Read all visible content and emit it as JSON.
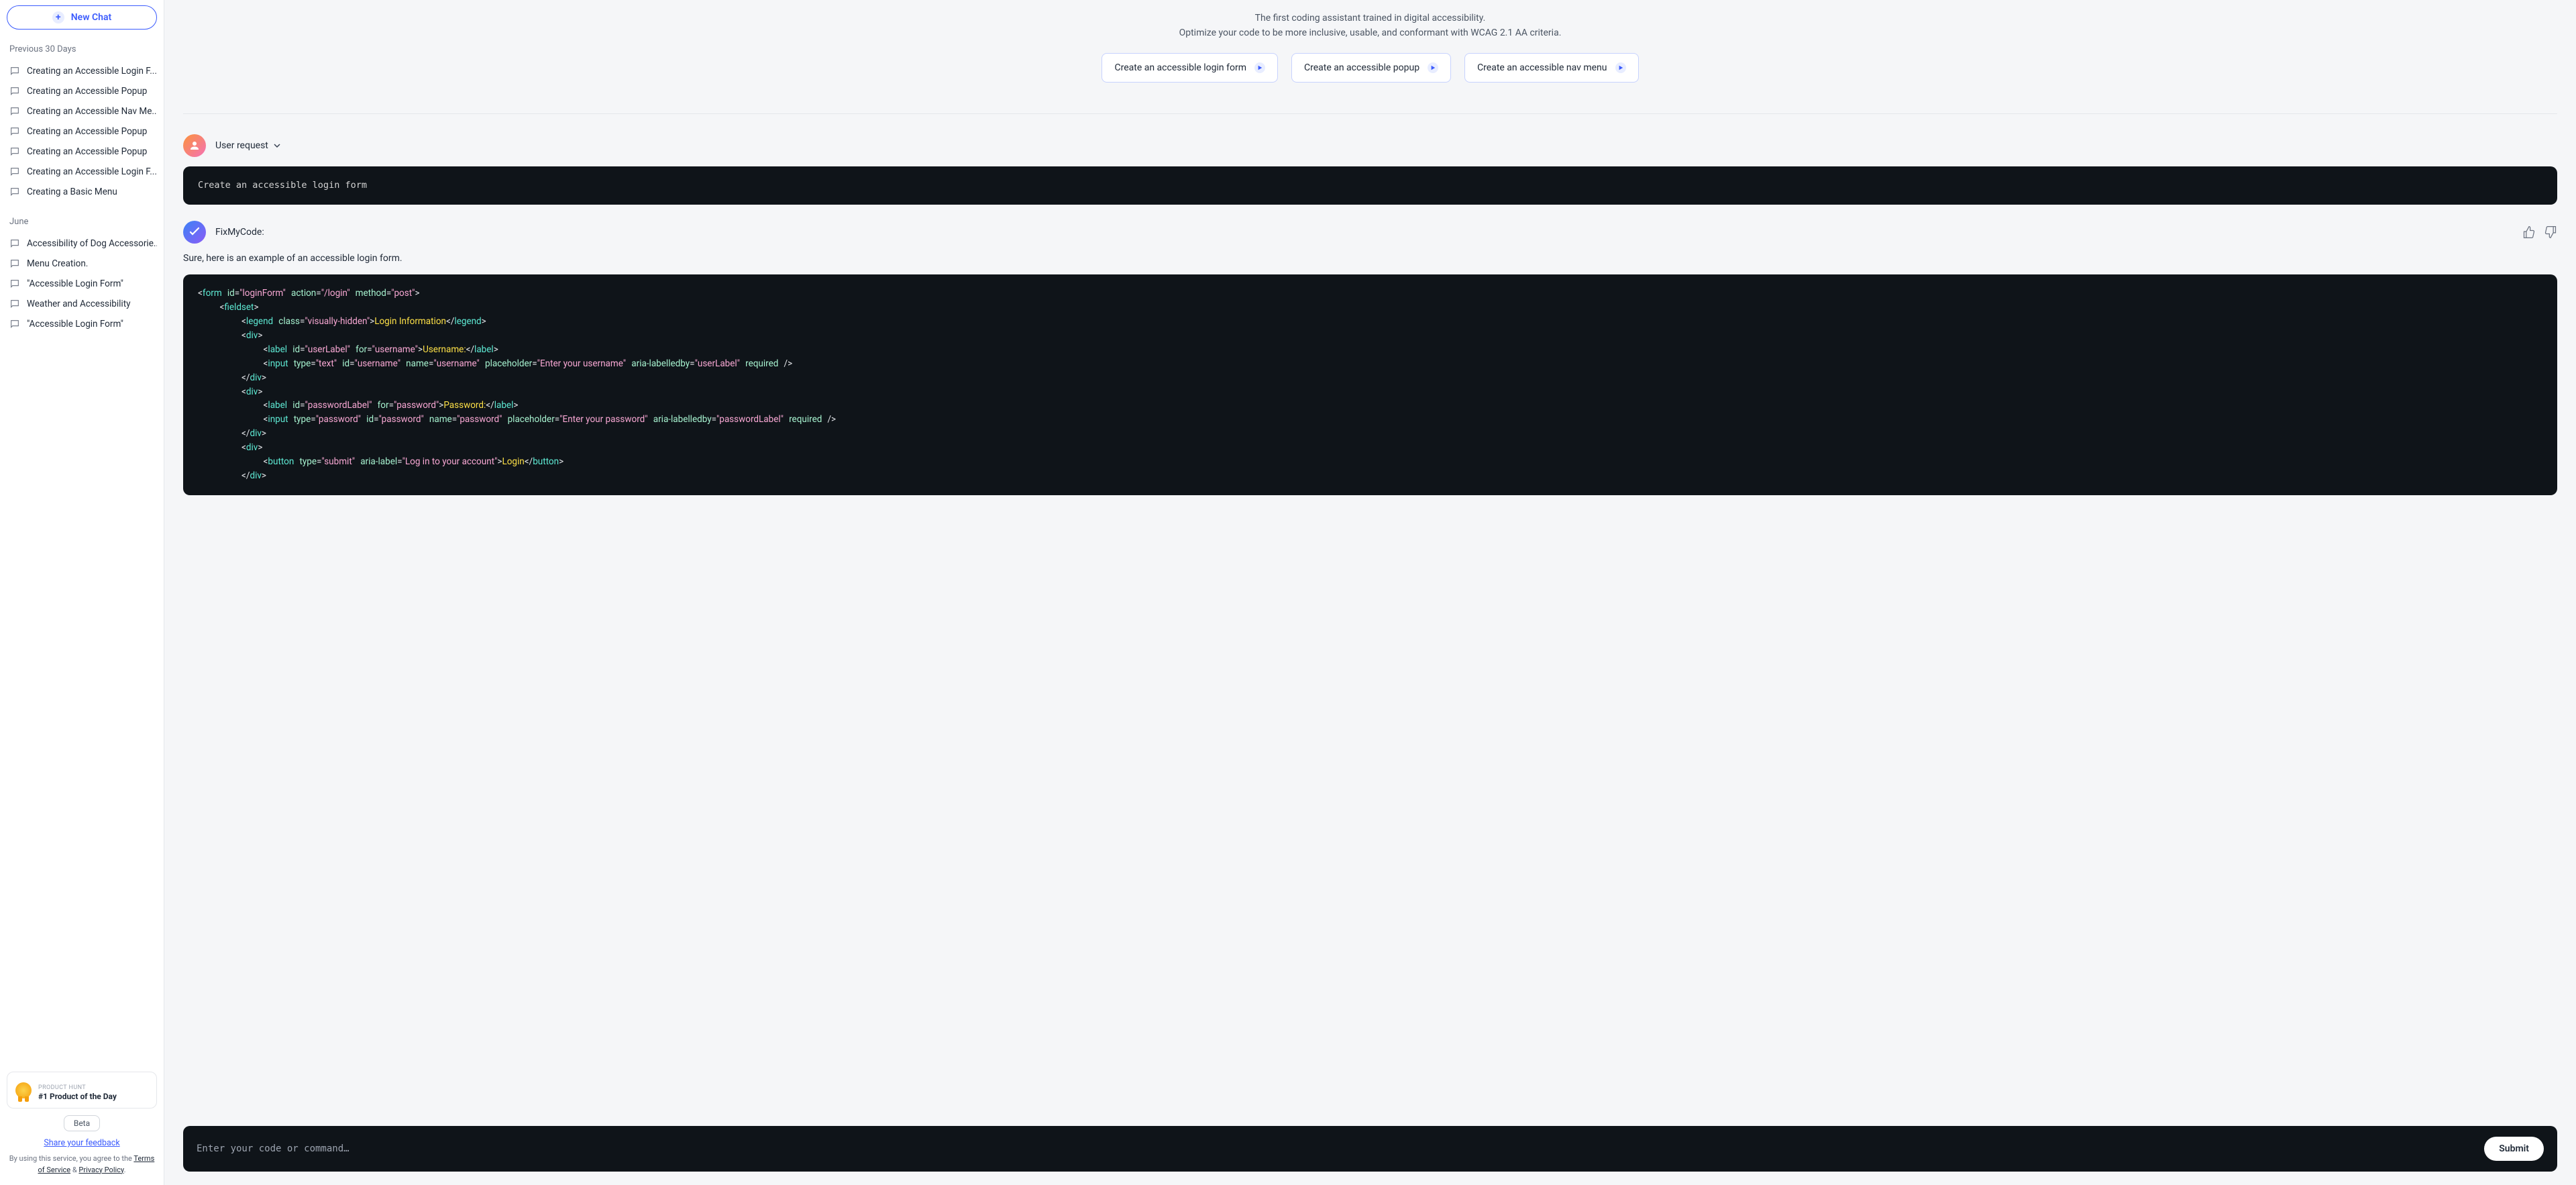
{
  "sidebar": {
    "newChat": "New Chat",
    "sections": {
      "recent": "Previous 30 Days",
      "june": "June"
    },
    "recent": [
      "Creating an Accessible Login F...",
      "Creating an Accessible Popup",
      "Creating an Accessible Nav Me...",
      "Creating an Accessible Popup",
      "Creating an Accessible Popup",
      "Creating an Accessible Login F...",
      "Creating a Basic Menu"
    ],
    "june": [
      "Accessibility of Dog Accessorie...",
      "Menu Creation.",
      "\"Accessible Login Form\"",
      "Weather and Accessibility",
      "\"Accessible Login Form\""
    ],
    "badge": {
      "eyebrow": "PRODUCT HUNT",
      "title": "#1 Product of the Day"
    },
    "beta": "Beta",
    "feedback": "Share your feedback",
    "termsPrefix": "By using this service, you agree to the ",
    "tos": "Terms of Service",
    "and": " & ",
    "privacy": "Privacy Policy",
    "period": "."
  },
  "hero": {
    "line1": "The first coding assistant trained in digital accessibility.",
    "line2": "Optimize your code to be more inclusive, usable, and conformant with WCAG 2.1 AA criteria.",
    "suggestions": [
      "Create an accessible login form",
      "Create an accessible popup",
      "Create an accessible nav menu"
    ]
  },
  "conversation": {
    "userLabel": "User request",
    "userMessage": "Create an accessible login form",
    "botLabel": "FixMyCode:",
    "botIntro": "Sure, here is an example of an accessible login form."
  },
  "input": {
    "placeholder": "Enter your code or command…",
    "submit": "Submit"
  }
}
